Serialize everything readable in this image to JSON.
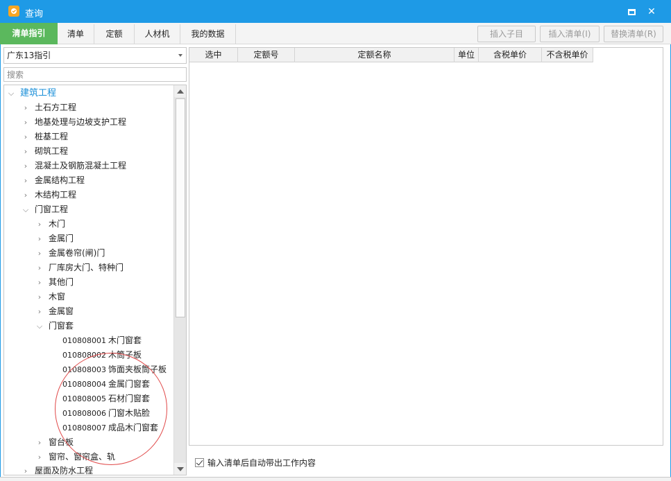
{
  "window": {
    "title": "查询",
    "maximize_icon": "maximize-icon",
    "close_icon": "close-icon",
    "title_bar_color": "#1e9ae6"
  },
  "tabs": [
    {
      "label": "清单指引",
      "active": true
    },
    {
      "label": "清单",
      "active": false
    },
    {
      "label": "定额",
      "active": false
    },
    {
      "label": "人材机",
      "active": false
    },
    {
      "label": "我的数据",
      "active": false
    }
  ],
  "toolbar": {
    "insert_sub_label": "插入子目",
    "insert_bill_label": "插入清单(I)",
    "replace_bill_label": "替换清单(R)"
  },
  "left": {
    "selected_guide": "广东13指引",
    "search_placeholder": "搜索"
  },
  "tree": {
    "root": "建筑工程",
    "level1": [
      "土石方工程",
      "地基处理与边坡支护工程",
      "桩基工程",
      "砌筑工程",
      "混凝土及钢筋混凝土工程",
      "金属结构工程",
      "木结构工程",
      "门窗工程"
    ],
    "level2": [
      "木门",
      "金属门",
      "金属卷帘(闸)门",
      "厂库房大门、特种门",
      "其他门",
      "木窗",
      "金属窗",
      "门窗套"
    ],
    "leaves": [
      {
        "code": "010808001",
        "name": "木门窗套"
      },
      {
        "code": "010808002",
        "name": "木筒子板"
      },
      {
        "code": "010808003",
        "name": "饰面夹板筒子板"
      },
      {
        "code": "010808004",
        "name": "金属门窗套"
      },
      {
        "code": "010808005",
        "name": "石材门窗套"
      },
      {
        "code": "010808006",
        "name": "门窗木贴脸"
      },
      {
        "code": "010808007",
        "name": "成品木门窗套"
      }
    ],
    "level2_after": [
      "窗台板",
      "窗帘、窗帘盒、轨"
    ],
    "level1_after": [
      "屋面及防水工程"
    ]
  },
  "grid": {
    "columns": [
      "选中",
      "定额号",
      "定额名称",
      "单位",
      "含税单价",
      "不含税单价"
    ]
  },
  "options": {
    "auto_bring_work_content": "输入清单后自动带出工作内容",
    "checked": true
  },
  "colors": {
    "active_tab": "#5bb85d",
    "root_text": "#1a8fd8",
    "annotation_circle": "#e04848"
  }
}
